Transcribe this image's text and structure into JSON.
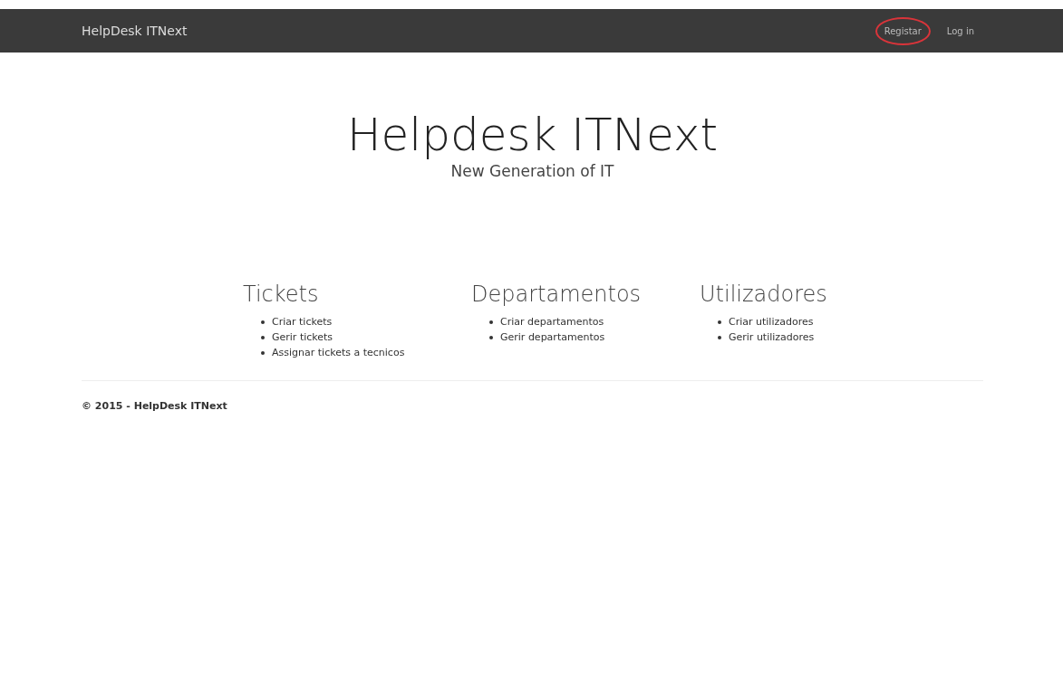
{
  "navbar": {
    "brand": "HelpDesk ITNext",
    "links": [
      {
        "label": "Registar",
        "circled": true
      },
      {
        "label": "Log in",
        "circled": false
      }
    ]
  },
  "hero": {
    "title": "Helpdesk ITNext",
    "subtitle": "New Generation of IT"
  },
  "sections": [
    {
      "heading": "Tickets",
      "items": [
        "Criar tickets",
        "Gerir tickets",
        "Assignar tickets a tecnicos"
      ]
    },
    {
      "heading": "Departamentos",
      "items": [
        "Criar departamentos",
        "Gerir departamentos"
      ]
    },
    {
      "heading": "Utilizadores",
      "items": [
        "Criar utilizadores",
        "Gerir utilizadores"
      ]
    }
  ],
  "footer": {
    "text": "© 2015 - HelpDesk ITNext"
  }
}
